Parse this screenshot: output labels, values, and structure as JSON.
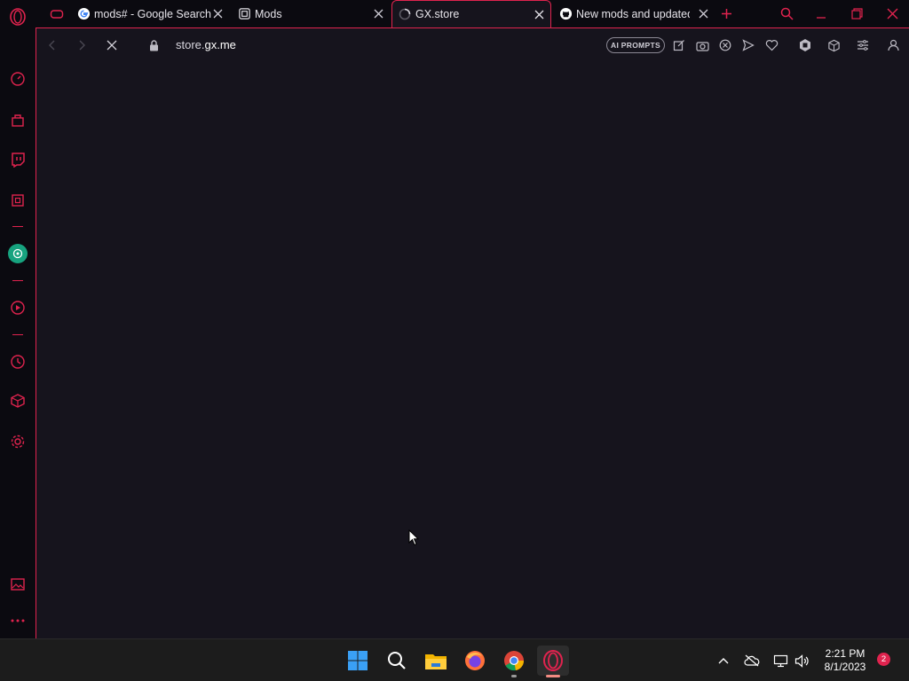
{
  "accent_color": "#e0234e",
  "tabs": [
    {
      "label": "mods# - Google Search",
      "icon": "google-icon"
    },
    {
      "label": "Mods",
      "icon": "mods-icon"
    },
    {
      "label": "GX.store",
      "icon": "loading-spinner-icon",
      "active": true
    },
    {
      "label": "New mods and updated",
      "icon": "github-icon"
    }
  ],
  "address_bar": {
    "url_prefix": "store.",
    "url_domain": "gx.me",
    "ai_prompts_label": "AI PROMPTS"
  },
  "taskbar": {
    "time": "2:21 PM",
    "date": "8/1/2023",
    "notification_count": "2"
  }
}
